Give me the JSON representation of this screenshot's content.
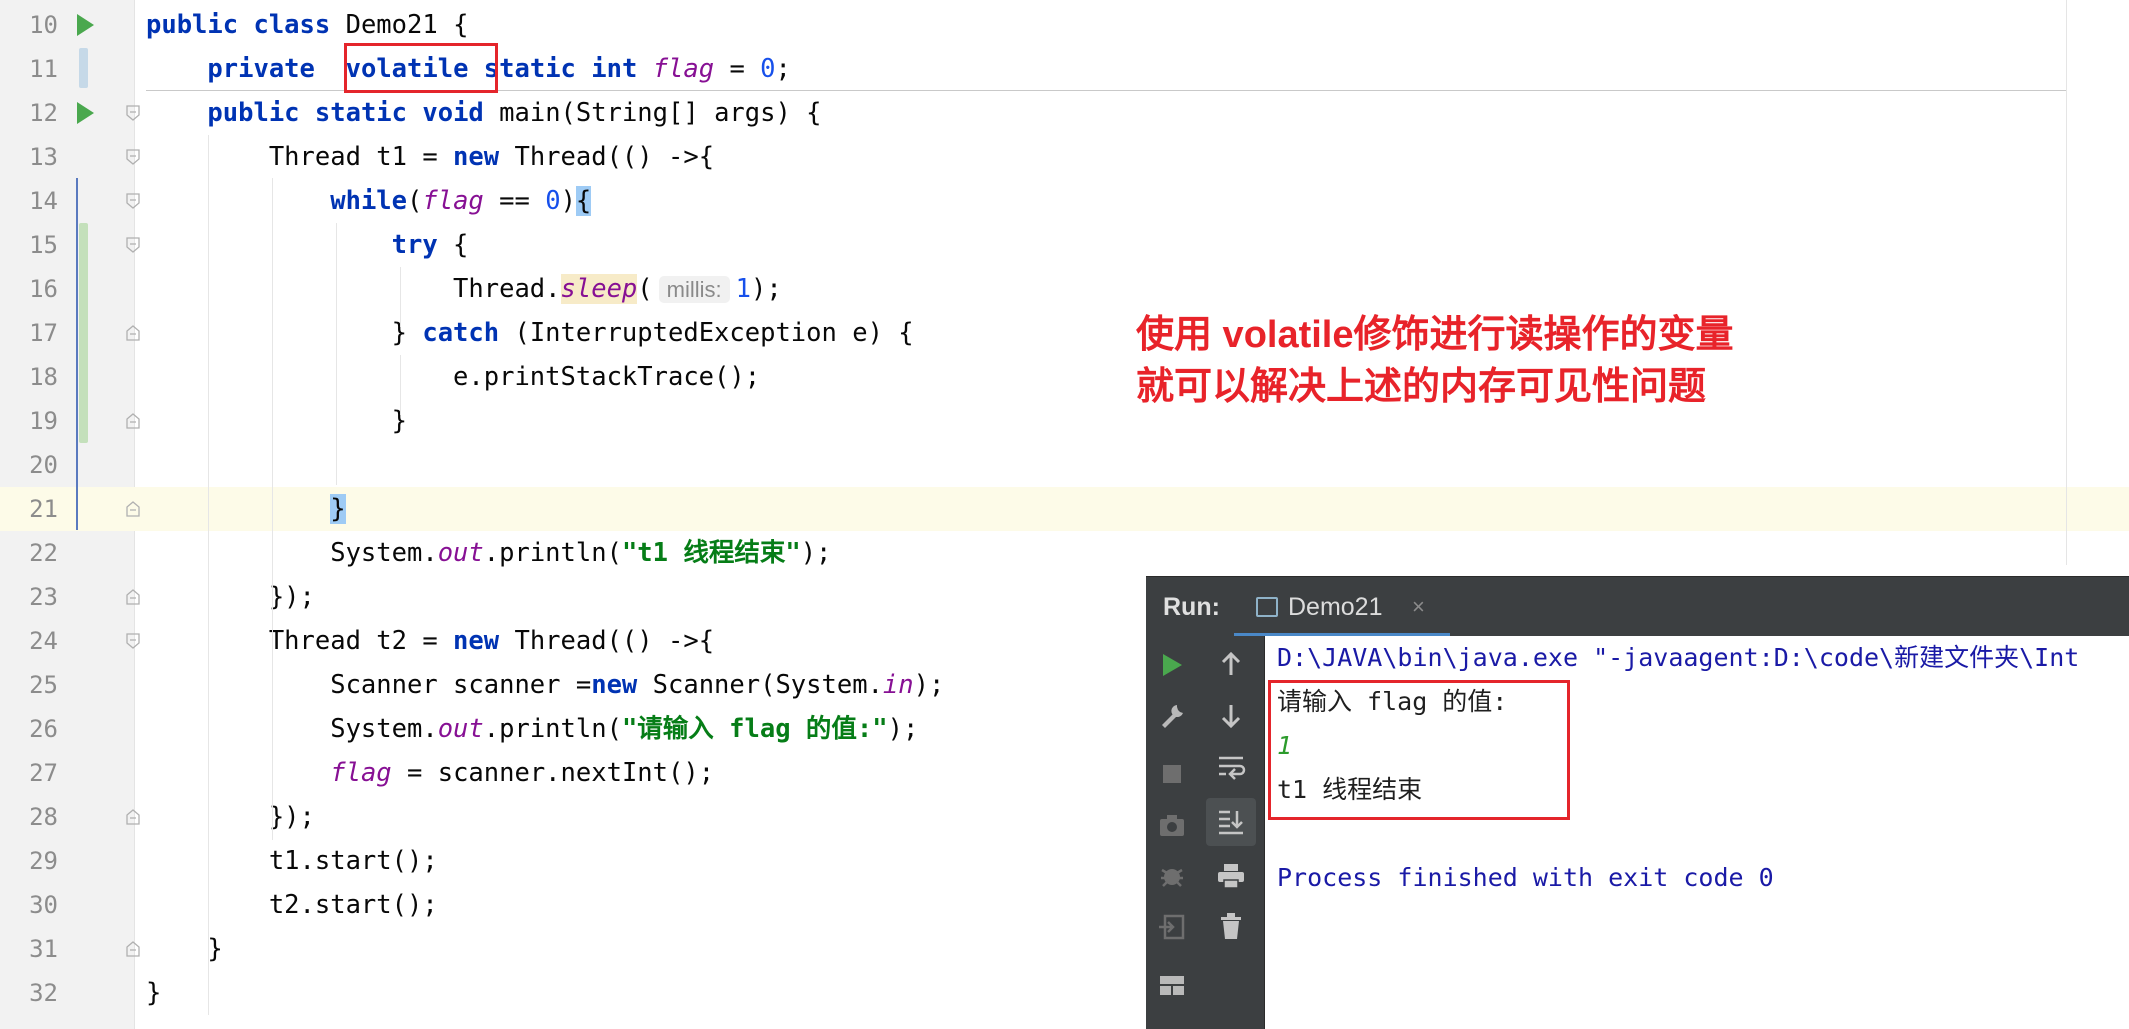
{
  "editor": {
    "lines": [
      {
        "n": "10",
        "parts": [
          [
            "kw",
            "public"
          ],
          [
            "",
            ""
          ],
          [
            "kw",
            " class"
          ],
          [
            "",
            " Demo21 {"
          ]
        ]
      },
      {
        "n": "11",
        "parts": [
          [
            "",
            "    "
          ],
          [
            "kw",
            "private"
          ],
          [
            "",
            "  "
          ],
          [
            "kw",
            "volatile"
          ],
          [
            "kw",
            " static"
          ],
          [
            "kw",
            " int"
          ],
          [
            "",
            " "
          ],
          [
            "fld",
            "flag"
          ],
          [
            "",
            " = "
          ],
          [
            "num",
            "0"
          ],
          [
            "",
            ";"
          ]
        ]
      },
      {
        "n": "12",
        "parts": [
          [
            "",
            "    "
          ],
          [
            "kw",
            "public"
          ],
          [
            "kw",
            " static"
          ],
          [
            "kw",
            " void"
          ],
          [
            "",
            " main(String[] args) {"
          ]
        ]
      },
      {
        "n": "13",
        "parts": [
          [
            "",
            "        Thread t1 = "
          ],
          [
            "kw",
            "new"
          ],
          [
            "",
            " Thread(() ->{"
          ]
        ]
      },
      {
        "n": "14",
        "parts": [
          [
            "",
            "            "
          ],
          [
            "kw",
            "while"
          ],
          [
            "",
            "("
          ],
          [
            "fld",
            "flag"
          ],
          [
            "",
            " == "
          ],
          [
            "num",
            "0"
          ],
          [
            "",
            ")"
          ],
          [
            "brace",
            "{"
          ]
        ]
      },
      {
        "n": "15",
        "parts": [
          [
            "",
            "                "
          ],
          [
            "kw",
            "try"
          ],
          [
            "",
            " {"
          ]
        ]
      },
      {
        "n": "16",
        "parts": [
          [
            "",
            "                    Thread."
          ],
          [
            "sleep",
            "sleep"
          ],
          [
            "",
            "("
          ],
          [
            "hint",
            "millis:"
          ],
          [
            "num",
            "1"
          ],
          [
            "",
            ");"
          ]
        ]
      },
      {
        "n": "17",
        "parts": [
          [
            "",
            "                } "
          ],
          [
            "kw",
            "catch"
          ],
          [
            "",
            " (InterruptedException e) {"
          ]
        ]
      },
      {
        "n": "18",
        "parts": [
          [
            "",
            "                    e.printStackTrace();"
          ]
        ]
      },
      {
        "n": "19",
        "parts": [
          [
            "",
            "                }"
          ]
        ]
      },
      {
        "n": "20",
        "parts": [
          [
            "",
            ""
          ]
        ]
      },
      {
        "n": "21",
        "parts": [
          [
            "",
            "            "
          ],
          [
            "brace",
            "}"
          ]
        ]
      },
      {
        "n": "22",
        "parts": [
          [
            "",
            "            System."
          ],
          [
            "fld",
            "out"
          ],
          [
            "",
            ".println("
          ],
          [
            "str",
            "\"t1 线程结束\""
          ],
          [
            "",
            ");"
          ]
        ]
      },
      {
        "n": "23",
        "parts": [
          [
            "",
            "        });"
          ]
        ]
      },
      {
        "n": "24",
        "parts": [
          [
            "",
            "        Thread t2 = "
          ],
          [
            "kw",
            "new"
          ],
          [
            "",
            " Thread(() ->{"
          ]
        ]
      },
      {
        "n": "25",
        "parts": [
          [
            "",
            "            Scanner scanner ="
          ],
          [
            "kw",
            "new"
          ],
          [
            "",
            " Scanner(System."
          ],
          [
            "fld",
            "in"
          ],
          [
            "",
            ");"
          ]
        ]
      },
      {
        "n": "26",
        "parts": [
          [
            "",
            "            System."
          ],
          [
            "fld",
            "out"
          ],
          [
            "",
            ".println("
          ],
          [
            "str",
            "\"请输入 flag 的值:\""
          ],
          [
            "",
            ");"
          ]
        ]
      },
      {
        "n": "27",
        "parts": [
          [
            "",
            "            "
          ],
          [
            "fld",
            "flag"
          ],
          [
            "",
            " = scanner.nextInt();"
          ]
        ]
      },
      {
        "n": "28",
        "parts": [
          [
            "",
            "        });"
          ]
        ]
      },
      {
        "n": "29",
        "parts": [
          [
            "",
            "        t1.start();"
          ]
        ]
      },
      {
        "n": "30",
        "parts": [
          [
            "",
            "        t2.start();"
          ]
        ]
      },
      {
        "n": "31",
        "parts": [
          [
            "",
            "    }"
          ]
        ]
      },
      {
        "n": "32",
        "parts": [
          [
            "",
            "}"
          ]
        ]
      }
    ],
    "current_line": "21",
    "run_gutter_lines": [
      "10",
      "12"
    ],
    "fold_open_lines": [
      "12",
      "13",
      "14",
      "15",
      "24"
    ],
    "fold_close_lines": [
      "17",
      "19",
      "21",
      "23",
      "28",
      "31"
    ]
  },
  "annotation": {
    "line1": "使用 volatile修饰进行读操作的变量",
    "line2": "就可以解决上述的内存可见性问题",
    "color": "#e8232a"
  },
  "run_panel": {
    "title": "Run:",
    "tab_name": "Demo21",
    "tab_close": "×",
    "console": {
      "command": "D:\\JAVA\\bin\\java.exe \"-javaagent:D:\\code\\新建文件夹\\Int",
      "prompt": "请输入 flag 的值:",
      "input": "1",
      "output": "t1 线程结束",
      "exit": "Process finished with exit code 0"
    },
    "toolbar_left": [
      "run-icon",
      "wrench-icon",
      "stop-icon",
      "camera-icon",
      "debug-icon",
      "exit-icon",
      "layout-icon"
    ],
    "toolbar_right": [
      "up-arrow-icon",
      "down-arrow-icon",
      "soft-wrap-icon",
      "scroll-to-end-icon",
      "print-icon",
      "trash-icon"
    ]
  },
  "colors": {
    "keyword": "#0033b3",
    "field": "#871094",
    "number": "#1750eb",
    "string": "#067d17",
    "highlight_box": "#e4252b",
    "run_panel_bg": "#3c3f41"
  }
}
